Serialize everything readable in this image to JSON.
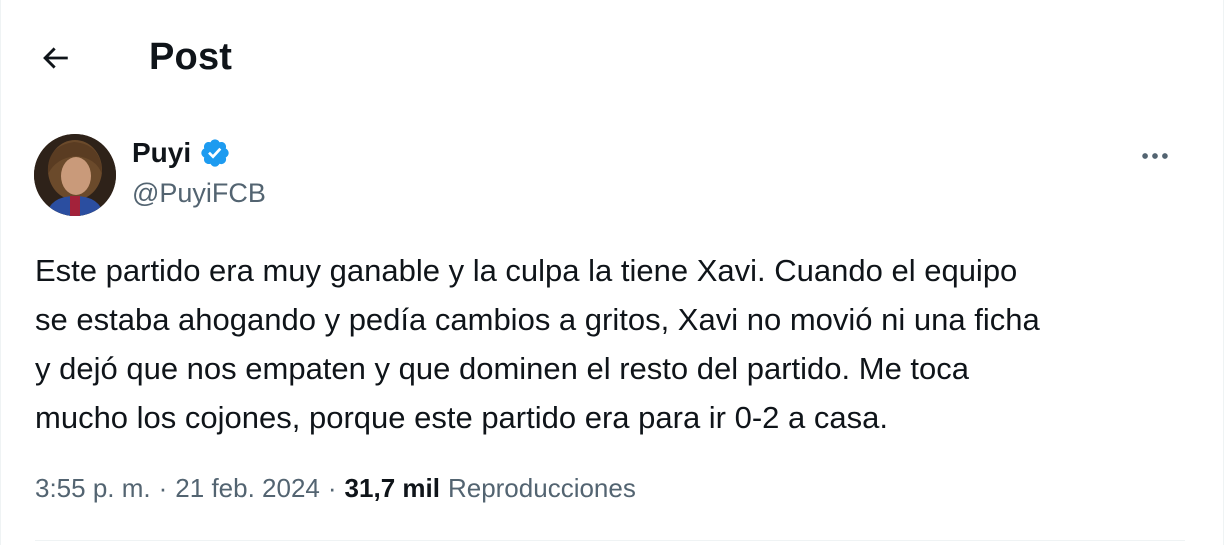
{
  "header": {
    "back_icon": "arrow-left-icon",
    "title": "Post"
  },
  "author": {
    "display_name": "Puyi",
    "verified_icon": "verified-badge-icon",
    "verified_color": "#1d9bf0",
    "handle": "@PuyiFCB",
    "more_icon": "more-horizontal-icon"
  },
  "tweet": {
    "text": "Este partido era muy ganable y la culpa la tiene Xavi. Cuando el equipo\nse estaba ahogando y pedía cambios a gritos, Xavi no movió ni una ficha\ny dejó que nos empaten y que dominen el resto del partido. Me toca\nmucho los cojones, porque este partido era para ir 0-2 a casa."
  },
  "meta": {
    "time": "3:55 p. m.",
    "separator": "·",
    "date": "21 feb. 2024",
    "views_count": "31,7 mil",
    "views_label": "Reproducciones"
  },
  "colors": {
    "text_primary": "#0f1419",
    "text_secondary": "#536471",
    "divider": "#eff3f4"
  }
}
